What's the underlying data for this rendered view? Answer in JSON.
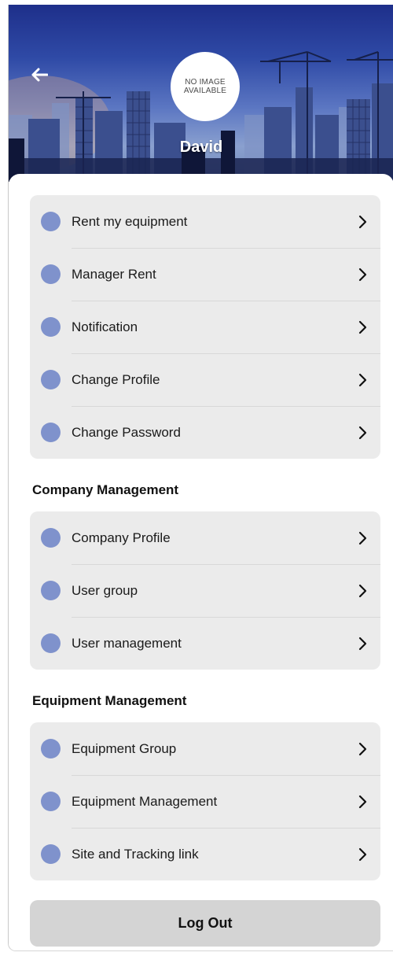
{
  "header": {
    "back_icon": "arrow-left-icon",
    "avatar_placeholder": "NO IMAGE AVAILABLE",
    "user_name": "David"
  },
  "menu": {
    "items": [
      {
        "label": "Rent my equipment",
        "icon": "circle-dot-icon"
      },
      {
        "label": "Manager Rent",
        "icon": "circle-dot-icon"
      },
      {
        "label": "Notification",
        "icon": "circle-dot-icon"
      },
      {
        "label": "Change Profile",
        "icon": "circle-dot-icon"
      },
      {
        "label": "Change Password",
        "icon": "circle-dot-icon"
      }
    ]
  },
  "company": {
    "title": "Company Management",
    "items": [
      {
        "label": "Company Profile",
        "icon": "circle-dot-icon"
      },
      {
        "label": "User group",
        "icon": "circle-dot-icon"
      },
      {
        "label": "User management",
        "icon": "circle-dot-icon"
      }
    ]
  },
  "equipment": {
    "title": "Equipment Management",
    "items": [
      {
        "label": "Equipment Group",
        "icon": "circle-dot-icon"
      },
      {
        "label": "Equipment Management",
        "icon": "circle-dot-icon"
      },
      {
        "label": "Site and Tracking link",
        "icon": "circle-dot-icon"
      }
    ]
  },
  "logout_label": "Log Out",
  "colors": {
    "accent_dot": "#7f92cc",
    "card_bg": "#ebebeb",
    "logout_bg": "#d4d4d4",
    "header_top": "#1e2f8a"
  }
}
